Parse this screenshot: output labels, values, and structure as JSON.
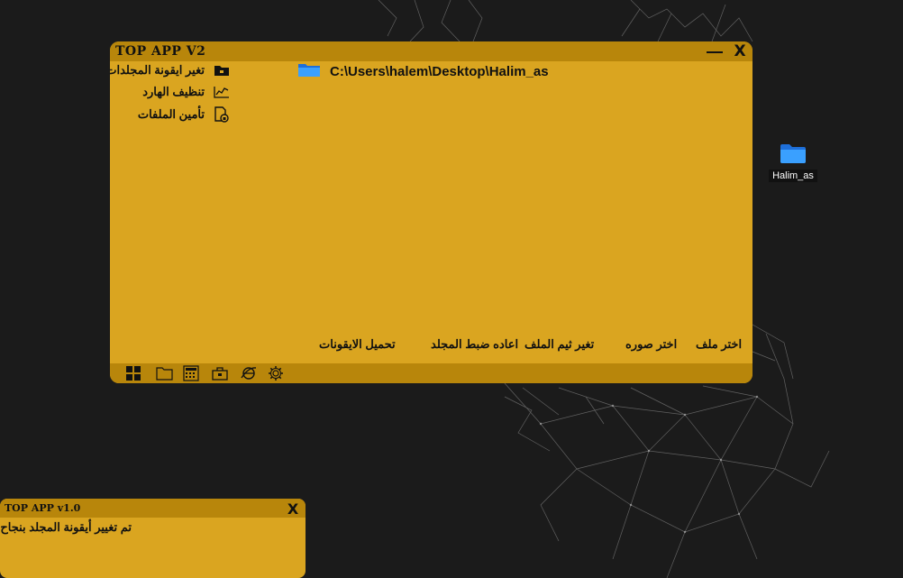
{
  "desktop": {
    "icon_label": "Halim_as",
    "background_color": "#1b1b1b"
  },
  "main_window": {
    "title": "TOP APP V2",
    "minimize_icon": "minimize-icon",
    "close_symbol": "X",
    "accent_color": "#daa520",
    "bar_color": "#b8860b",
    "sidebar": [
      {
        "label": "تغير ايقونة المجلدات",
        "icon": "folder-icon"
      },
      {
        "label": "تنظيف الهارد",
        "icon": "chart-icon"
      },
      {
        "label": "تأمين الملفات",
        "icon": "file-lock-icon"
      }
    ],
    "current_path": "C:\\Users\\halem\\Desktop\\Halim_as",
    "actions": {
      "load_icons": "تحميل الايقونات",
      "reset_folder": "اعاده ضبط المجلد",
      "change_file_theme": "تغير ثيم الملف",
      "choose_image": "اختر صوره",
      "choose_file": "اختر ملف"
    },
    "taskbar_icons": [
      "windows-icon",
      "folder-icon",
      "calculator-icon",
      "briefcase-icon",
      "browser-icon",
      "gear-icon"
    ]
  },
  "notification_window": {
    "title": "TOP APP v1.0",
    "close_symbol": "X",
    "message": "تم تغيير أيقونة المجلد بنجاح"
  }
}
